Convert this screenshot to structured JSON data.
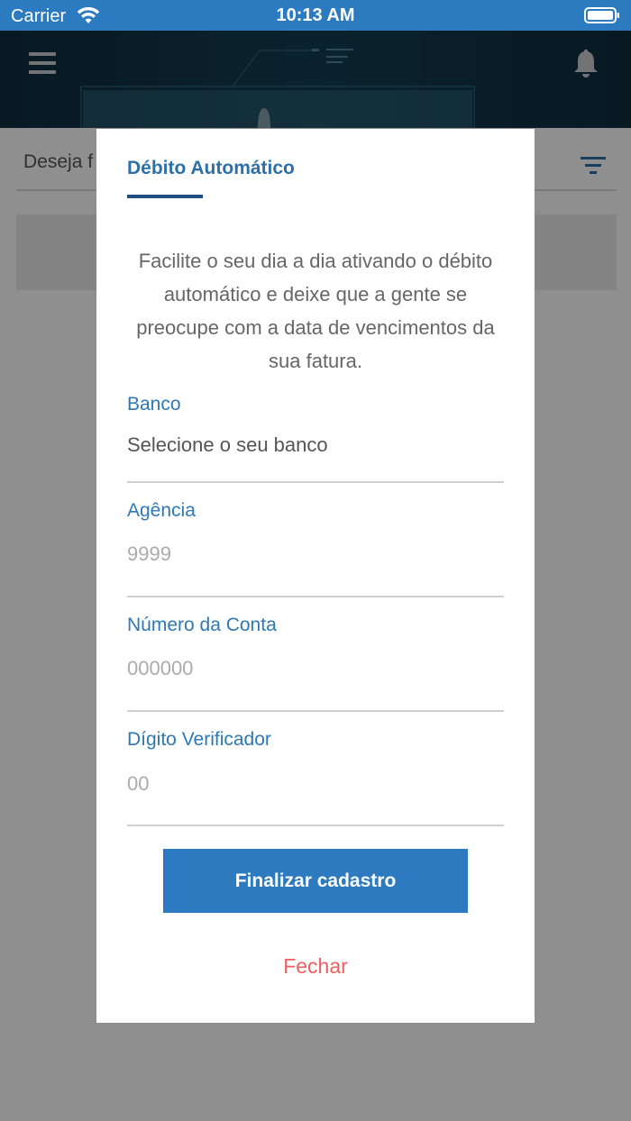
{
  "status_bar": {
    "carrier": "Carrier",
    "time": "10:13 AM"
  },
  "header": {
    "menu_icon": "hamburger-icon",
    "notification_icon": "bell-icon"
  },
  "page": {
    "search_placeholder": "Deseja f",
    "filter_icon": "filter-icon"
  },
  "modal": {
    "tab_title": "Débito Automático",
    "description": "Facilite o seu dia a dia ativando o débito automático e deixe que a gente se preocupe com a data de vencimentos da sua fatura.",
    "fields": [
      {
        "label": "Banco",
        "value": "Selecione o seu banco"
      },
      {
        "label": "Agência",
        "value": "9999"
      },
      {
        "label": "Número da Conta",
        "value": "000000"
      },
      {
        "label": "Dígito Verificador",
        "value": "00"
      }
    ],
    "submit_label": "Finalizar cadastro",
    "close_label": "Fechar"
  },
  "colors": {
    "accent": "#2d7ac0",
    "close": "#ee5e5e",
    "tab_underline": "#1f4f86"
  }
}
